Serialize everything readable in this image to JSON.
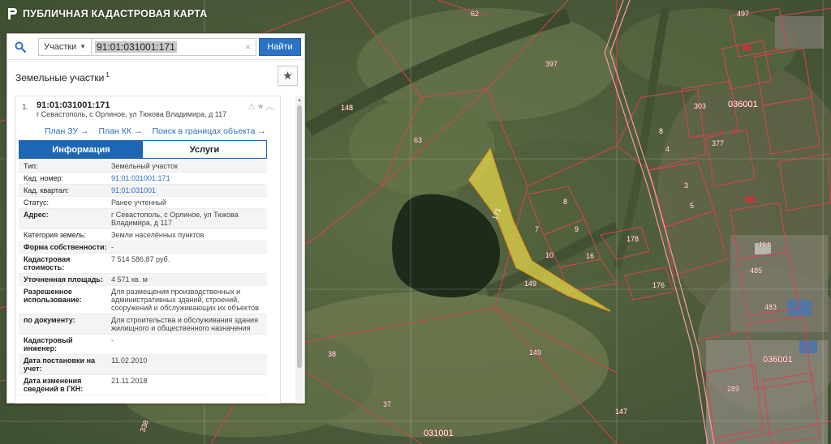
{
  "app": {
    "title": "ПУБЛИЧНАЯ КАДАСТРОВАЯ КАРТА"
  },
  "search": {
    "type_value": "Участки",
    "query_value": "91:01:031001:171",
    "find_label": "Найти"
  },
  "section": {
    "title": "Земельные участки",
    "count": "1"
  },
  "result": {
    "index": "1.",
    "cadastral_number": "91:01:031001:171",
    "address": "г Севастополь, с Орлиное, ул Тюкова Владимира, д 117",
    "links": [
      "План ЗУ →",
      "План КК →",
      "Поиск в границах объекта →"
    ],
    "tabs": [
      "Информация",
      "Услуги"
    ],
    "properties": [
      {
        "key": "Тип:",
        "value": "Земельный участок"
      },
      {
        "key": "Кад. номер:",
        "value": "91:01:031001:171"
      },
      {
        "key": "Кад. квартал:",
        "value": "91:01:031001"
      },
      {
        "key": "Статус:",
        "value": "Ранее учтенный"
      },
      {
        "key": "Адрес:",
        "value": "г Севастополь, с Орлиное, ул Тюкова Владимира, д 117"
      },
      {
        "key": "Категория земель:",
        "value": "Земли населённых пунктов"
      },
      {
        "key": "Форма собственности:",
        "value": "-"
      },
      {
        "key": "Кадастровая стоимость:",
        "value": "7 514 586,87 руб."
      },
      {
        "key": "Уточненная площадь:",
        "value": "4 571 кв. м"
      },
      {
        "key": "Разрешенное использование:",
        "value": "Для размещения производственных и административных зданий, строений, сооружений и обслуживающих их объектов"
      },
      {
        "key": "по документу:",
        "value": "Для строительства и обслуживания здания жилищного и общественного назначения"
      },
      {
        "key": "Кадастровый инженер:",
        "value": "-"
      },
      {
        "key": "Дата постановки на учет:",
        "value": "11.02.2010"
      },
      {
        "key": "Дата изменения сведений в ГКН:",
        "value": "21.11.2018"
      }
    ]
  },
  "map": {
    "parcel_labels": [
      "62",
      "497",
      "397",
      "148",
      "63",
      "303",
      "036001",
      "8",
      "4",
      "377",
      "8",
      "7",
      "9",
      "10",
      "16",
      "178",
      "176",
      "149",
      "3",
      "5",
      "485",
      "483",
      "464",
      "149",
      "38",
      "37",
      "036001",
      "289",
      "147",
      "031001",
      "338",
      "171"
    ],
    "colors": {
      "boundary": "#d9434f",
      "selected_fill": "#e8d94a",
      "selected_stroke": "#e0a020"
    }
  }
}
